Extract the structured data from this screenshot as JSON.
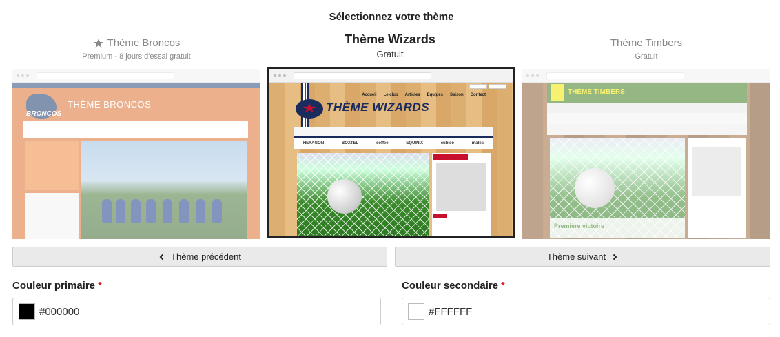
{
  "section_title": "Sélectionnez votre thème",
  "themes": {
    "previous": {
      "name": "Thème Broncos",
      "subtitle": "Premium - 8 jours d'essai gratuit",
      "preview_title": "THÈME BRONCOS",
      "preview_logo": "BRONCOS"
    },
    "current": {
      "name": "Thème Wizards",
      "subtitle": "Gratuit",
      "preview_title": "THÈME WIZARDS",
      "preview_nav": [
        "Accueil",
        "Le club",
        "Articles",
        "Equipes",
        "Saison",
        "Contact"
      ],
      "preview_sponsors": [
        "HEXAGON",
        "BOXTEL",
        "coffee",
        "EQUINIX",
        "cubico",
        "mates"
      ]
    },
    "next": {
      "name": "Thème Timbers",
      "subtitle": "Gratuit",
      "preview_title": "THÈME TIMBERS",
      "preview_caption": "Première victoire"
    }
  },
  "buttons": {
    "prev_label": "Thème précédent",
    "next_label": "Thème suivant"
  },
  "fields": {
    "primary": {
      "label": "Couleur primaire",
      "required_mark": "*",
      "value": "#000000",
      "swatch_color": "#000000"
    },
    "secondary": {
      "label": "Couleur secondaire",
      "required_mark": "*",
      "value": "#FFFFFF",
      "swatch_color": "#FFFFFF"
    }
  }
}
